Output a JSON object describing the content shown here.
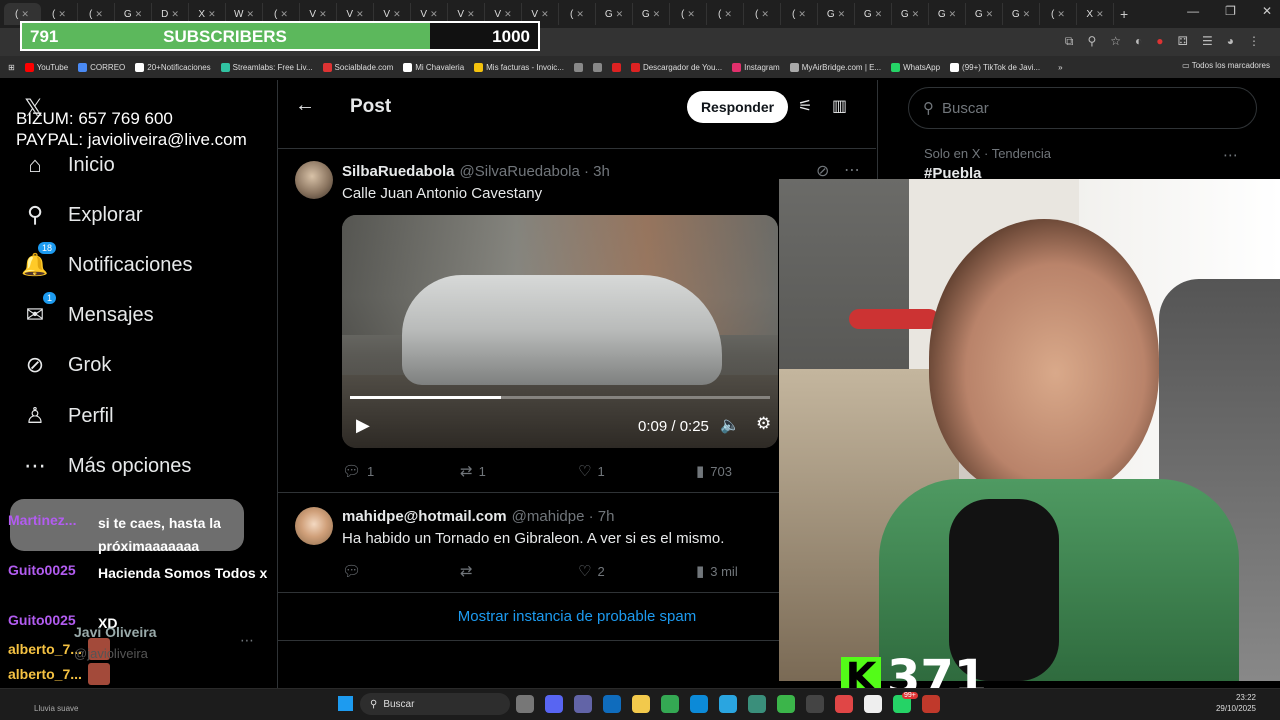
{
  "browser": {
    "tabs": [
      "(",
      "(",
      "(",
      "G",
      "D",
      "X",
      "W",
      "(",
      "V",
      "V",
      "V",
      "V",
      "V",
      "V",
      "V",
      "(",
      "G",
      "G",
      "(",
      "(",
      "(",
      "(",
      "G",
      "G",
      "G",
      "G",
      "G",
      "G",
      "(",
      "X"
    ],
    "new_tab": "+",
    "window_controls": [
      "—",
      "❐",
      "✕"
    ],
    "bookmarks": [
      {
        "label": "YouTube",
        "color": "#ff0000"
      },
      {
        "label": "CORREO",
        "color": "#4a8af4"
      },
      {
        "label": "20+Notificaciones",
        "color": "#ffffff"
      },
      {
        "label": "Streamlabs: Free Liv...",
        "color": "#31c3a2"
      },
      {
        "label": "Socialblade.com",
        "color": "#d33"
      },
      {
        "label": "Mi Chavaleria",
        "color": "#fff"
      },
      {
        "label": "Mis facturas - Invoic...",
        "color": "#f4c20d"
      },
      {
        "label": "",
        "color": "#888"
      },
      {
        "label": "",
        "color": "#888"
      },
      {
        "label": "",
        "color": "#d22"
      },
      {
        "label": "Descargador de You...",
        "color": "#d22"
      },
      {
        "label": "Instagram",
        "color": "#e1306c"
      },
      {
        "label": "MyAirBridge.com | E...",
        "color": "#aaa"
      },
      {
        "label": "WhatsApp",
        "color": "#25d366"
      },
      {
        "label": "(99+) TikTok de Javi...",
        "color": "#fff"
      }
    ],
    "bookmarks_more": "»",
    "all_bookmarks": "Todos los marcadores"
  },
  "subgoal": {
    "count": "791",
    "label": "SUBSCRIBERS",
    "target": "1000",
    "progress_fraction": 0.791
  },
  "donate": {
    "bizum": "BIZUM: 657 769 600",
    "paypal": "PAYPAL: javioliveira@live.com"
  },
  "sidebar": {
    "logo": "𝕏",
    "items": [
      {
        "label": "Inicio",
        "icon": "home-icon",
        "glyph": "⌂",
        "badge": ""
      },
      {
        "label": "Explorar",
        "icon": "search-icon",
        "glyph": "⚲",
        "badge": ""
      },
      {
        "label": "Notificaciones",
        "icon": "bell-icon",
        "glyph": "🔔",
        "badge": "18"
      },
      {
        "label": "Mensajes",
        "icon": "mail-icon",
        "glyph": "✉",
        "badge": "1"
      },
      {
        "label": "Grok",
        "icon": "grok-icon",
        "glyph": "⊘",
        "badge": ""
      },
      {
        "label": "Perfil",
        "icon": "person-icon",
        "glyph": "♙",
        "badge": ""
      },
      {
        "label": "Más opciones",
        "icon": "more-icon",
        "glyph": "⋯",
        "badge": ""
      }
    ],
    "account": {
      "name": "Javi Oliveira",
      "handle": "@javioliveira"
    }
  },
  "chat": [
    {
      "user": "Martinez...",
      "message": "si te caes, hasta la próximaaaaaaa"
    },
    {
      "user": "Guito0025",
      "message": "Hacienda Somos Todos x"
    },
    {
      "user": "Guito0025",
      "message": "XD"
    }
  ],
  "chat_mini": [
    "alberto_7...",
    "alberto_7...",
    "alberto_7..."
  ],
  "main": {
    "header": {
      "title": "Post",
      "reply_button": "Responder"
    },
    "tweets": [
      {
        "name": "SilbaRuedabola",
        "handle": "@SilvaRuedabola · 3h",
        "text": "Calle Juan Antonio Cavestany",
        "metrics": {
          "replies": "1",
          "reposts": "1",
          "likes": "1",
          "views": "703"
        }
      },
      {
        "name": "mahidpe@hotmail.com",
        "handle": "@mahidpe · 7h",
        "text": "Ha habido un Tornado en Gibraleon. A ver si es el mismo.",
        "metrics": {
          "replies": "",
          "reposts": "",
          "likes": "2",
          "views": "3 mil"
        }
      }
    ],
    "video": {
      "time": "0:09 / 0:25",
      "progress_fraction": 0.36
    },
    "spam_link": "Mostrar instancia de probable spam"
  },
  "right": {
    "search_placeholder": "Buscar",
    "trend": {
      "subtitle": "Solo en X · Tendencia",
      "name": "#Puebla"
    }
  },
  "overlay": {
    "kick_count": "371",
    "kick_logo": "K"
  },
  "taskbar": {
    "search": "Buscar",
    "weather": "Lluvia suave",
    "time": "23:22",
    "date": "29/10/2025",
    "notif_badge": "99+"
  }
}
